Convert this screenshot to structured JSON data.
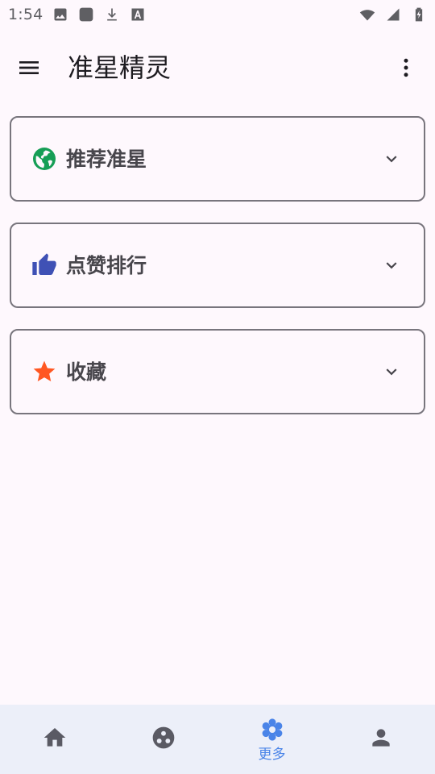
{
  "status_bar": {
    "time": "1:54",
    "left_icons": [
      "image-icon",
      "app-square-icon",
      "download-icon",
      "text-a-icon"
    ],
    "right_icons": [
      "wifi-icon",
      "signal-icon",
      "battery-charging-icon"
    ]
  },
  "app_bar": {
    "title": "准星精灵",
    "menu_icon": "menu-icon",
    "more_icon": "more-vertical-icon"
  },
  "sections": [
    {
      "label": "推荐准星",
      "icon": "globe-icon",
      "icon_color": "#169e56"
    },
    {
      "label": "点赞排行",
      "icon": "thumb-up-icon",
      "icon_color": "#3f51b5"
    },
    {
      "label": "收藏",
      "icon": "star-icon",
      "icon_color": "#ff5722"
    }
  ],
  "bottom_nav": {
    "items": [
      {
        "id": "home",
        "icon": "home-icon",
        "label": "",
        "active": false
      },
      {
        "id": "discover",
        "icon": "dots-circle-icon",
        "label": "",
        "active": false
      },
      {
        "id": "more",
        "icon": "flower-icon",
        "label": "更多",
        "active": true
      },
      {
        "id": "profile",
        "icon": "person-icon",
        "label": "",
        "active": false
      }
    ],
    "active_color": "#4a84e8",
    "inactive_color": "#5a5a64"
  },
  "colors": {
    "background": "#fef8fd",
    "card_border": "#78757d",
    "nav_background": "#eceff9"
  }
}
